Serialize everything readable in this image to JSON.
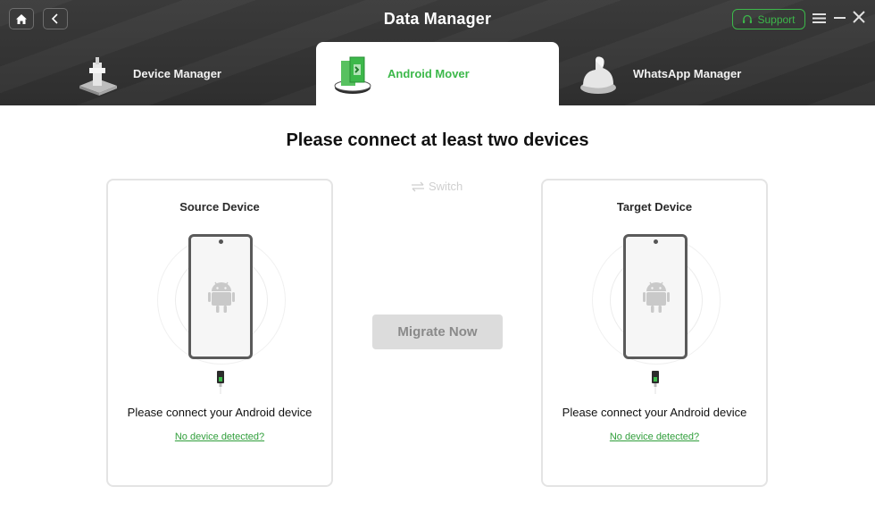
{
  "header": {
    "title": "Data Manager",
    "support_label": "Support",
    "icons": [
      "home-icon",
      "back-icon",
      "headset-icon",
      "menu-icon",
      "minimize-icon",
      "close-icon"
    ]
  },
  "tabs": [
    {
      "label": "Device Manager",
      "active": false,
      "icon": "device-manager-icon"
    },
    {
      "label": "Android Mover",
      "active": true,
      "icon": "android-mover-icon"
    },
    {
      "label": "WhatsApp Manager",
      "active": false,
      "icon": "whatsapp-manager-icon"
    }
  ],
  "main": {
    "title": "Please connect at least two devices",
    "switch_label": "Switch",
    "migrate_label": "Migrate Now",
    "source": {
      "title": "Source Device",
      "message": "Please connect your Android device",
      "link": "No device detected?"
    },
    "target": {
      "title": "Target Device",
      "message": "Please connect your Android device",
      "link": "No device detected?"
    }
  },
  "colors": {
    "accent": "#3cb84a",
    "header_bg": "#333333",
    "button_disabled": "#dcdcdc"
  }
}
